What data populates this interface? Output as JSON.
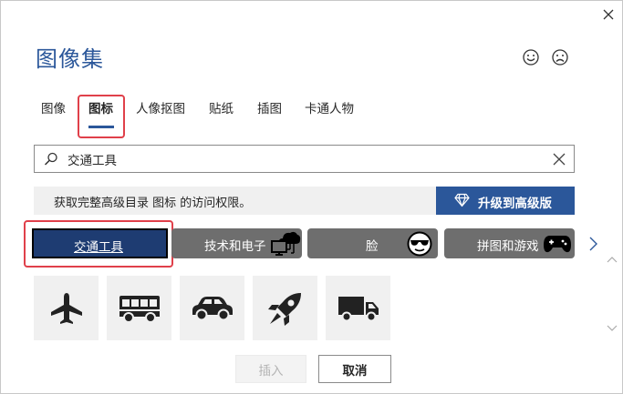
{
  "dialog": {
    "title": "图像集",
    "close_icon": "close-icon",
    "feedback": {
      "smile_icon": "smiley-face-icon",
      "frown_icon": "frowny-face-icon"
    }
  },
  "tabs": [
    {
      "label": "图像",
      "active": false
    },
    {
      "label": "图标",
      "active": true
    },
    {
      "label": "人像抠图",
      "active": false
    },
    {
      "label": "贴纸",
      "active": false
    },
    {
      "label": "插图",
      "active": false
    },
    {
      "label": "卡通人物",
      "active": false
    }
  ],
  "search": {
    "value": "交通工具",
    "search_icon": "search-icon",
    "clear_icon": "clear-icon"
  },
  "upsell": {
    "message": "获取完整高级目录 图标 的访问权限。",
    "button_label": "升级到高级版",
    "button_icon": "diamond-icon"
  },
  "categories": [
    {
      "label": "交通工具",
      "selected": true,
      "icon": ""
    },
    {
      "label": "技术和电子",
      "selected": false,
      "icon": "cloud-device-icon"
    },
    {
      "label": "脸",
      "selected": false,
      "icon": "sunglasses-face-icon"
    },
    {
      "label": "拼图和游戏",
      "selected": false,
      "icon": "gamepad-icon"
    }
  ],
  "tiles": [
    {
      "icon": "airplane-icon"
    },
    {
      "icon": "bus-icon"
    },
    {
      "icon": "car-icon"
    },
    {
      "icon": "rocket-icon"
    },
    {
      "icon": "truck-icon"
    }
  ],
  "footer": {
    "insert_label": "插入",
    "cancel_label": "取消"
  },
  "colors": {
    "accent": "#2b579a",
    "highlight": "#e0404a",
    "category_bg": "#6e6e6e",
    "tile_bg": "#f0f0f0"
  }
}
